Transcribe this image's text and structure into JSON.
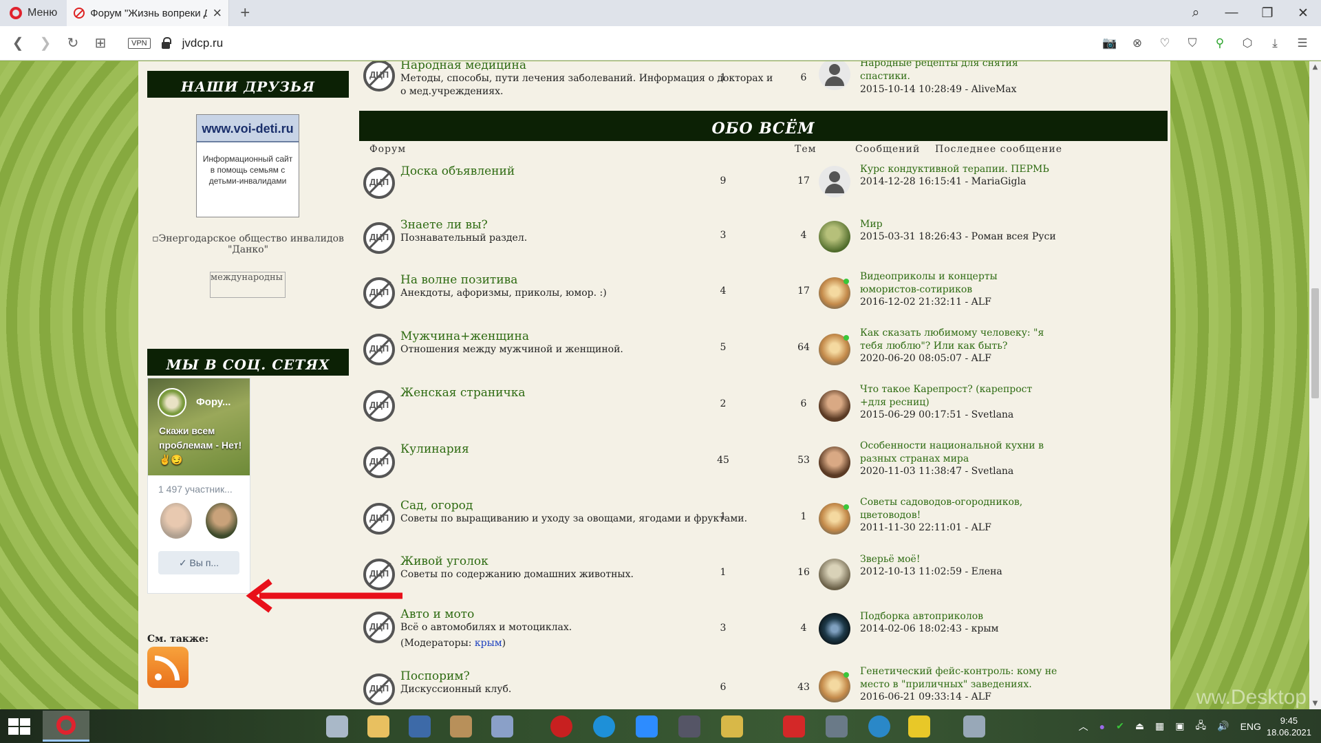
{
  "browser": {
    "menu_label": "Меню",
    "tab_title": "Форум \"Жизнь вопреки Д",
    "url": "jvdcp.ru",
    "vpn_label": "VPN",
    "accent": "#e0232e"
  },
  "sidebar": {
    "friends_heading": "НАШИ ДРУЗЬЯ",
    "voi_banner": {
      "site": "www.voi-deti.ru",
      "text": "Информационный сайт в помощь семьям с детьми-инвалидами"
    },
    "danko_alt": "Энергодарское общество инвалидов \"Данко\"",
    "intl_alt": "международны",
    "social_heading": "МЫ В СОЦ. СЕТЯХ",
    "vk_widget": {
      "group_name": "Фору...",
      "slogan": "Скажи всем проблемам - Нет!✌😏",
      "members": "1 497 участник...",
      "button": "Вы п..."
    },
    "see_also": "См. также:"
  },
  "top_row": {
    "name": "Народная медицина",
    "desc": "Методы, способы, пути лечения заболеваний. Информация о докторах и о мед.учреждениях.",
    "topics": "1",
    "posts": "6",
    "last_title": "Народные рецепты для снятия спастики.",
    "last_meta": "2015-10-14 10:28:49 - AliveMax"
  },
  "section": {
    "heading": "ОБО ВСЁМ",
    "col_forum": "Форум",
    "col_topics": "Тем",
    "col_posts": "Сообщений",
    "col_last": "Последнее сообщение"
  },
  "forums": [
    {
      "name": "Доска объявлений",
      "desc": "",
      "topics": "9",
      "posts": "17",
      "last_title": "Курс кондуктивной терапии. ПЕРМЬ",
      "last_meta": "2014-12-28 16:15:41 - MariaGigla"
    },
    {
      "name": "Знаете ли вы?",
      "desc": "Познавательный раздел.",
      "topics": "3",
      "posts": "4",
      "last_title": "Мир",
      "last_meta": "2015-03-31 18:26:43 - Роман всея Руси"
    },
    {
      "name": "На волне позитива",
      "desc": "Анекдоты, афоризмы, приколы, юмор. :)",
      "topics": "4",
      "posts": "17",
      "last_title": "Видеоприколы и концерты юмористов-сотириков",
      "last_meta": "2016-12-02 21:32:11 - ALF"
    },
    {
      "name": "Мужчина+женщина",
      "desc": "Отношения между мужчиной и женщиной.",
      "topics": "5",
      "posts": "64",
      "last_title": "Как сказать любимому человеку: \"я тебя люблю\"? Или как быть?",
      "last_meta": "2020-06-20 08:05:07 - ALF"
    },
    {
      "name": "Женская страничка",
      "desc": "",
      "topics": "2",
      "posts": "6",
      "last_title": "Что такое Карепрост? (карепрост +для ресниц)",
      "last_meta": "2015-06-29 00:17:51 - Svetlana"
    },
    {
      "name": "Кулинария",
      "desc": "",
      "topics": "45",
      "posts": "53",
      "last_title": "Особенности национальной кухни в разных странах мира",
      "last_meta": "2020-11-03 11:38:47 - Svetlana"
    },
    {
      "name": "Сад, огород",
      "desc": "Советы по выращиванию и уходу за овощами, ягодами и фруктами.",
      "topics": "1",
      "posts": "1",
      "last_title": "Советы садоводов-огородников, цветоводов!",
      "last_meta": "2011-11-30 22:11:01 - ALF"
    },
    {
      "name": "Живой уголок",
      "desc": "Советы по содержанию домашних животных.",
      "topics": "1",
      "posts": "16",
      "last_title": "Зверьё моё!",
      "last_meta": "2012-10-13 11:02:59 - Елена"
    },
    {
      "name": "Авто и мото",
      "desc": "Всё о автомобилях и мотоциклах.",
      "moderators_label": "(Модераторы: ",
      "moderator": "крым",
      "moderators_close": ")",
      "topics": "3",
      "posts": "4",
      "last_title": "Подборка автоприколов",
      "last_meta": "2014-02-06 18:02:43 - крым"
    },
    {
      "name": "Поспорим?",
      "desc": "Дискуссионный клуб.",
      "topics": "6",
      "posts": "43",
      "last_title": "Генетический фейс-контроль: кому не место в \"приличных\" заведениях.",
      "last_meta": "2016-06-21 09:33:14 - ALF"
    }
  ],
  "taskbar": {
    "lang": "ENG",
    "time": "9:45",
    "date": "18.06.2021"
  },
  "watermark": "ww.Desktop"
}
